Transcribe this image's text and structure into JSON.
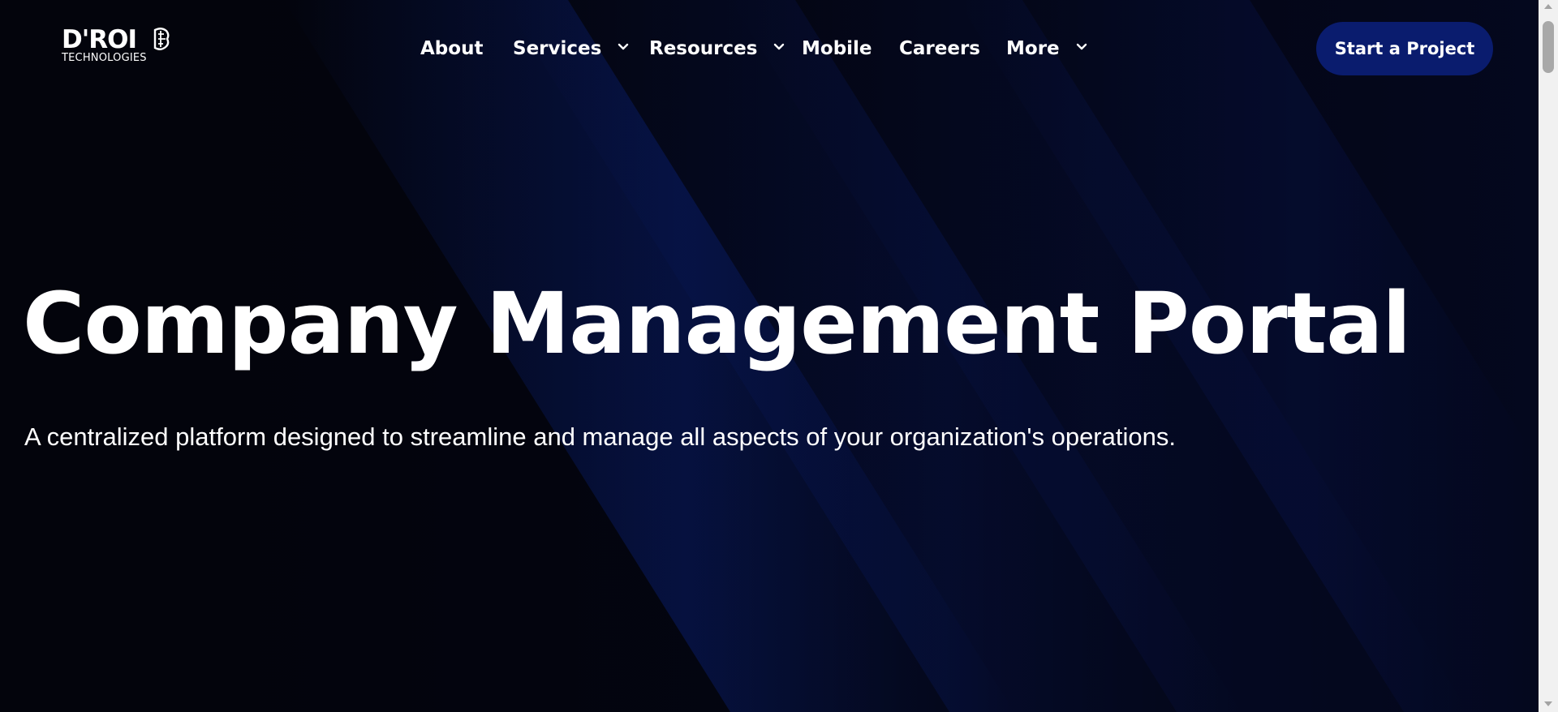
{
  "brand": {
    "logo_main": "D'ROI",
    "logo_sub": "TECHNOLOGIES"
  },
  "nav": {
    "items": [
      {
        "label": "About",
        "has_dropdown": false
      },
      {
        "label": "Services",
        "has_dropdown": true
      },
      {
        "label": "Resources",
        "has_dropdown": true
      },
      {
        "label": "Mobile",
        "has_dropdown": false
      },
      {
        "label": "Careers",
        "has_dropdown": false
      },
      {
        "label": "More",
        "has_dropdown": true
      }
    ],
    "cta_label": "Start a Project"
  },
  "hero": {
    "title": "Company Management Portal",
    "subtitle": "A centralized platform designed to streamline and manage all aspects of your organization's operations."
  },
  "colors": {
    "background": "#03040c",
    "accent_blue": "#0a1c6e",
    "stripe_blue": "#0b2a9c",
    "text": "#ffffff"
  },
  "icons": {
    "dropdown": "chevron-down-icon",
    "logo_mark": "brain-icon"
  }
}
